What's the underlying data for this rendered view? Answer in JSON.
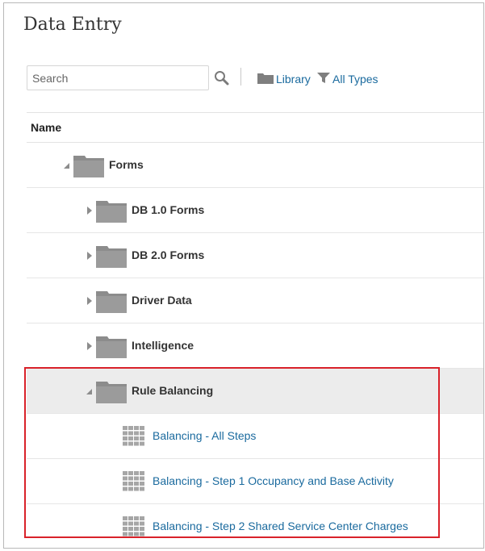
{
  "page": {
    "title": "Data Entry"
  },
  "toolbar": {
    "search_placeholder": "Search",
    "search_value": "",
    "library_label": "Library",
    "all_types_label": "All Types"
  },
  "grid": {
    "column_name": "Name",
    "rows": [
      {
        "label": "Forms",
        "kind": "folder",
        "level": 0,
        "expanded": true
      },
      {
        "label": "DB 1.0 Forms",
        "kind": "folder",
        "level": 1,
        "expanded": false
      },
      {
        "label": "DB 2.0 Forms",
        "kind": "folder",
        "level": 1,
        "expanded": false
      },
      {
        "label": "Driver Data",
        "kind": "folder",
        "level": 1,
        "expanded": false
      },
      {
        "label": "Intelligence",
        "kind": "folder",
        "level": 1,
        "expanded": false
      },
      {
        "label": "Rule Balancing",
        "kind": "folder",
        "level": 1,
        "expanded": true,
        "selected": true
      },
      {
        "label": "Balancing - All Steps",
        "kind": "form",
        "level": 2
      },
      {
        "label": "Balancing - Step 1 Occupancy and Base Activity",
        "kind": "form",
        "level": 2
      },
      {
        "label": "Balancing - Step 2 Shared Service Center Charges",
        "kind": "form",
        "level": 2
      }
    ]
  },
  "colors": {
    "link": "#1a6a9e",
    "folder": "#8c8c8c",
    "selected_row": "#ececec",
    "highlight": "#d9222a"
  },
  "icons": {
    "search": "search-icon",
    "library": "folder-icon",
    "filter": "filter-icon",
    "expanded": "triangle-down-icon",
    "collapsed": "triangle-right-icon",
    "form": "grid-form-icon"
  }
}
